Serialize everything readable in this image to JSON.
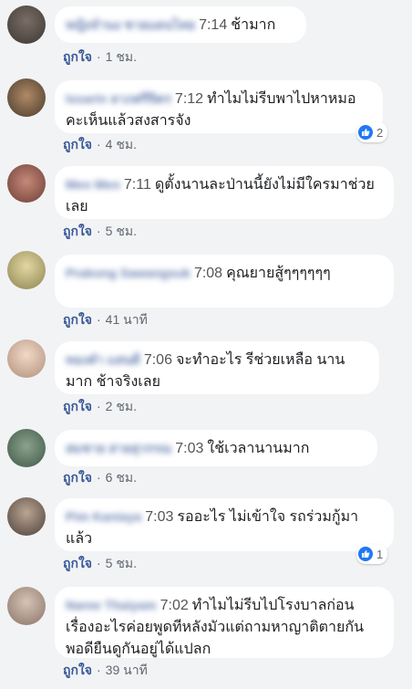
{
  "comments": [
    {
      "name": "หญิงจำนง ชายแดนไทย",
      "time": "7:14",
      "text": "ช้ามาก",
      "like_label": "ถูกใจ",
      "ago": "1 ชม.",
      "reactions": ""
    },
    {
      "name": "Issarin ลาภศรีจิตร",
      "time": "7:12",
      "text": "ทำไมไม่รีบพาไปหาหมอคะเห็นแล้วสงสารจัง",
      "like_label": "ถูกใจ",
      "ago": "4 ชม.",
      "reactions": "2"
    },
    {
      "name": "Meo Meo",
      "time": "7:11",
      "text": "ดูตั้งนานละป่านนี้ยังไม่มีใครมาช่วยเลย",
      "like_label": "ถูกใจ",
      "ago": "5 ชม.",
      "reactions": ""
    },
    {
      "name": "Prakong Sawangsuk",
      "time": "7:08",
      "text": "คุณยายสู้ๆๆๆๆๆๆ",
      "like_label": "ถูกใจ",
      "ago": "41 นาที",
      "reactions": ""
    },
    {
      "name": "ทองคำ แสนดี",
      "time": "7:06",
      "text": "จะทำอะไร รีช่วยเหลือ นานมาก ช้าจริงเลย",
      "like_label": "ถูกใจ",
      "ago": "2 ชม.",
      "reactions": ""
    },
    {
      "name": "สมชาย สายสุวรรณ",
      "time": "7:03",
      "text": "ใช้เวลานานมาก",
      "like_label": "ถูกใจ",
      "ago": "6 ชม.",
      "reactions": ""
    },
    {
      "name": "Pim Kaniaya",
      "time": "7:03",
      "text": "รออะไร ไม่เข้าใจ รถร่วมกู้มาแล้ว",
      "like_label": "ถูกใจ",
      "ago": "5 ชม.",
      "reactions": "1"
    },
    {
      "name": "Naree Thaiyam",
      "time": "7:02",
      "text": "ทำไมไม่รีบไปโรงบาลก่อนเรื่องอะไรค่อยพูดทีหลังมัวแต่ถามหาญาติตายกันพอดียืนดูกันอยู่ได้แปลก",
      "like_label": "ถูกใจ",
      "ago": "39 นาที",
      "reactions": ""
    }
  ],
  "colors": {
    "bubble": "#ffffff",
    "background": "#f2f3f5",
    "link": "#385898",
    "like_badge": "#2078f4"
  }
}
